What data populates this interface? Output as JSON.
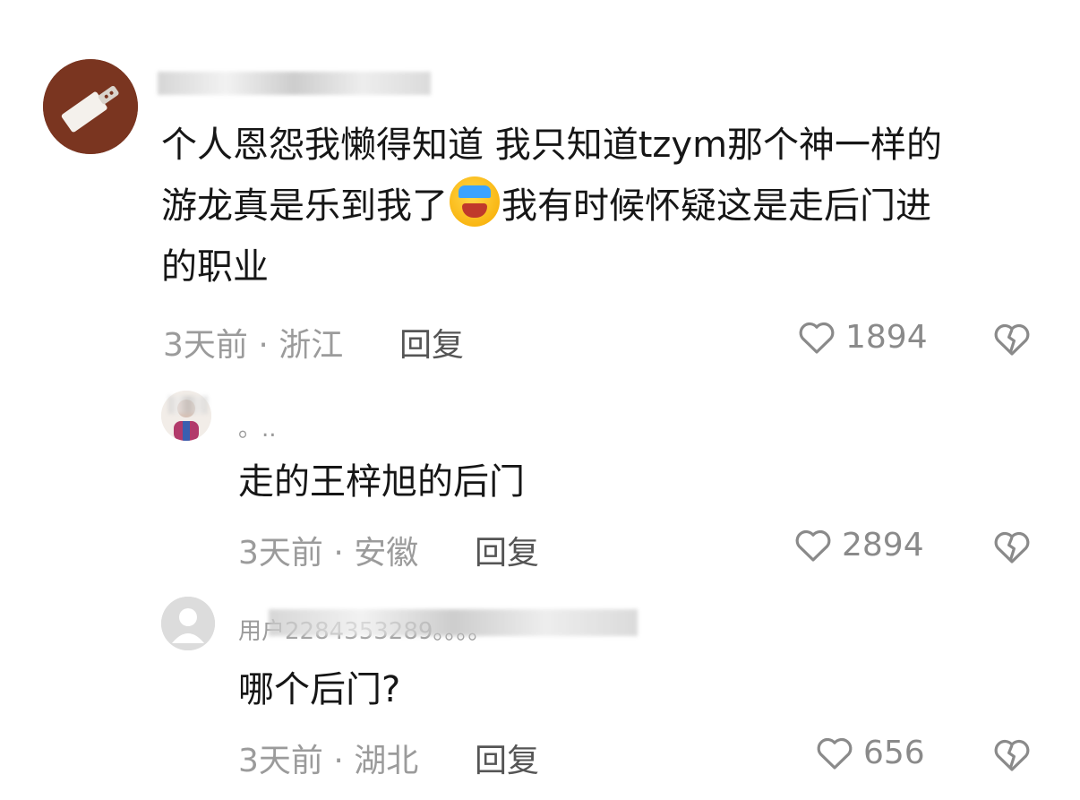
{
  "comments": [
    {
      "text_lines": [
        "个人恩怨我懒得知道 我只知道tzym那个神一样的",
        "游龙真是乐到我了",
        "我有时候怀疑这是走后门进",
        "的职业"
      ],
      "emoji": "laughing-crying-emoji",
      "meta": "3天前 · 浙江",
      "reply_label": "回复",
      "likes": "1894"
    },
    {
      "username_visible": "。..",
      "text": "走的王梓旭的后门",
      "meta": "3天前 · 安徽",
      "reply_label": "回复",
      "likes": "2894"
    },
    {
      "username_visible": "用户2284353289。。。。",
      "text": "哪个后门?",
      "meta": "3天前 · 湖北",
      "reply_label": "回复",
      "likes": "656"
    }
  ],
  "icons": {
    "like": "heart-outline-icon",
    "dislike": "broken-heart-icon"
  },
  "colors": {
    "text": "#161616",
    "meta": "#9b9b9b",
    "icon": "#8a8a8a"
  }
}
